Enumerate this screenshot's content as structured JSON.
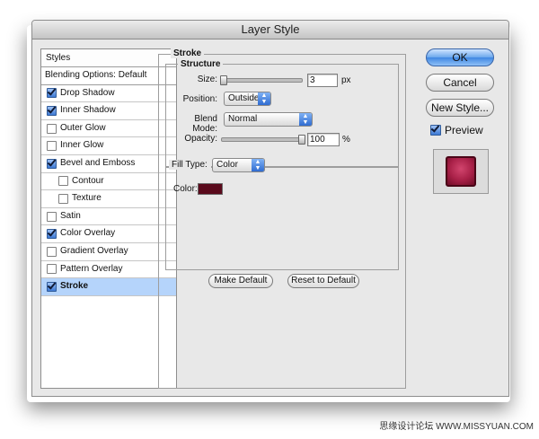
{
  "window": {
    "title": "Layer Style"
  },
  "styles_panel": {
    "header": "Styles",
    "blending_options": "Blending Options: Default",
    "items": [
      {
        "label": "Drop Shadow",
        "checked": true,
        "sub": false,
        "selected": false
      },
      {
        "label": "Inner Shadow",
        "checked": true,
        "sub": false,
        "selected": false
      },
      {
        "label": "Outer Glow",
        "checked": false,
        "sub": false,
        "selected": false
      },
      {
        "label": "Inner Glow",
        "checked": false,
        "sub": false,
        "selected": false
      },
      {
        "label": "Bevel and Emboss",
        "checked": true,
        "sub": false,
        "selected": false
      },
      {
        "label": "Contour",
        "checked": false,
        "sub": true,
        "selected": false
      },
      {
        "label": "Texture",
        "checked": false,
        "sub": true,
        "selected": false
      },
      {
        "label": "Satin",
        "checked": false,
        "sub": false,
        "selected": false
      },
      {
        "label": "Color Overlay",
        "checked": true,
        "sub": false,
        "selected": false
      },
      {
        "label": "Gradient Overlay",
        "checked": false,
        "sub": false,
        "selected": false
      },
      {
        "label": "Pattern Overlay",
        "checked": false,
        "sub": false,
        "selected": false
      },
      {
        "label": "Stroke",
        "checked": true,
        "sub": false,
        "selected": true
      }
    ]
  },
  "stroke": {
    "group_title": "Stroke",
    "structure_title": "Structure",
    "size_label": "Size:",
    "size_value": "3",
    "size_unit": "px",
    "position_label": "Position:",
    "position_value": "Outside",
    "blend_mode_label": "Blend Mode:",
    "blend_mode_value": "Normal",
    "opacity_label": "Opacity:",
    "opacity_value": "100",
    "opacity_unit": "%",
    "fill_type_label": "Fill Type:",
    "fill_type_value": "Color",
    "color_label": "Color:",
    "color_value": "#5a0a1c",
    "make_default": "Make Default",
    "reset_default": "Reset to Default"
  },
  "buttons": {
    "ok": "OK",
    "cancel": "Cancel",
    "new_style": "New Style...",
    "preview_label": "Preview",
    "preview_checked": true
  },
  "watermark": "思缘设计论坛 WWW.MISSYUAN.COM"
}
